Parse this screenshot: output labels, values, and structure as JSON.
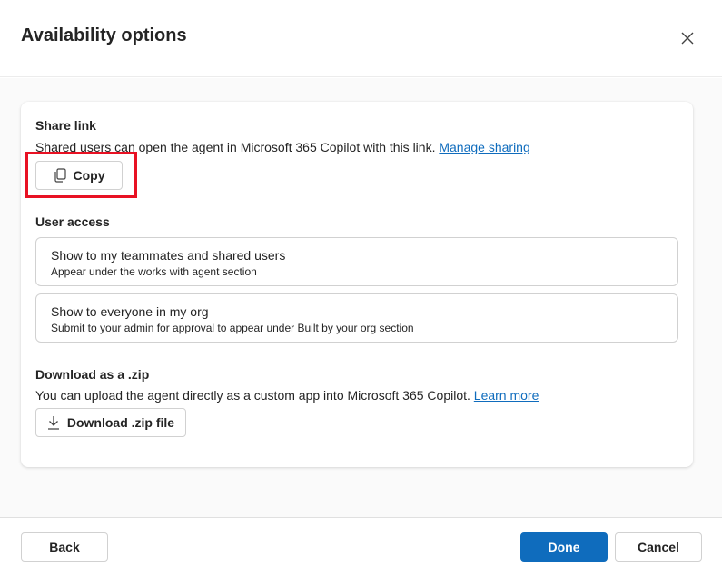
{
  "dialog": {
    "title": "Availability options"
  },
  "share_link": {
    "title": "Share link",
    "description": "Shared users can open the agent in Microsoft 365 Copilot with this link.",
    "manage_link": "Manage sharing",
    "copy_label": "Copy"
  },
  "user_access": {
    "title": "User access",
    "options": [
      {
        "title": "Show to my teammates and shared users",
        "description": "Appear under the works with agent section"
      },
      {
        "title": "Show to everyone in my org",
        "description": "Submit to your admin for approval to appear under Built by your org section"
      }
    ]
  },
  "download": {
    "title": "Download as a .zip",
    "description": "You can upload the agent directly as a custom app into Microsoft 365 Copilot.",
    "learn_more": "Learn more",
    "button_label": "Download .zip file"
  },
  "footer": {
    "back_label": "Back",
    "done_label": "Done",
    "cancel_label": "Cancel"
  },
  "colors": {
    "primary": "#0f6cbd",
    "highlight": "#e81123"
  }
}
